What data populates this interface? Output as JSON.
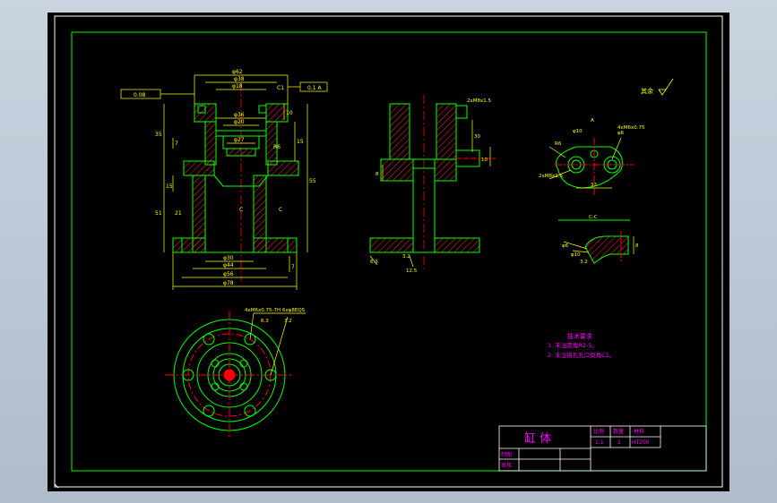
{
  "colors": {
    "frame": "#ffffff",
    "border": "#00ff00",
    "part": "#00ff00",
    "dimension": "#ffff00",
    "centerline": "#ff0000",
    "hatch": "#ff0000",
    "notes": "#ff00ff",
    "title": "#ff00ff"
  },
  "front_view": {
    "dims_top": [
      "φ62",
      "φ38",
      "φ18",
      "φ36",
      "φ20",
      "φ27"
    ],
    "dims_bottom": [
      "φ30",
      "φ44",
      "φ56",
      "φ78"
    ],
    "dims_left": [
      "35",
      "7",
      "15",
      "51",
      "21"
    ],
    "dims_right": [
      "10",
      "15",
      "55",
      "7"
    ],
    "section_mark": "C",
    "chamfer": "C1",
    "radius": "R6",
    "tol_left": "0.08",
    "tol_right": "0.1 A"
  },
  "side_view": {
    "dims": [
      "30",
      "8",
      "2xM8x1.5",
      "10"
    ],
    "roughness": [
      "3.2",
      "6.3",
      "12.5"
    ]
  },
  "detail_a": {
    "label": "A",
    "dims": [
      "φ10",
      "φ6",
      "R6",
      "33",
      "4xM6x0.75",
      "2xM8x1.5"
    ]
  },
  "section_cc": {
    "label": "C-C",
    "dims": [
      "φ6",
      "φ10",
      "8",
      "3.2"
    ]
  },
  "plan_view": {
    "dims": [
      "4xM6x0.75-7H",
      "6xφ8EQS",
      "6.3",
      "3.2"
    ]
  },
  "roughness_note": "其余",
  "notes": {
    "title": "技术要求",
    "items": [
      "1. 未注圆角R2-5。",
      "2. 未注铸孔孔口倒角C1。"
    ]
  },
  "title_block": {
    "name": "缸 体",
    "headers": [
      "比例",
      "数量",
      "材料"
    ],
    "values": [
      "1:1",
      "1",
      "HT200"
    ],
    "row1": "制图",
    "row2": "审核"
  }
}
